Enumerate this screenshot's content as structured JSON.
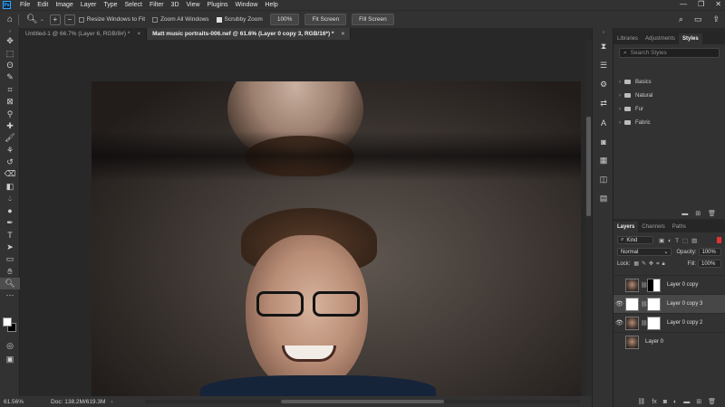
{
  "menubar": {
    "logo": "Ps",
    "items": [
      "File",
      "Edit",
      "Image",
      "Layer",
      "Type",
      "Select",
      "Filter",
      "3D",
      "View",
      "Plugins",
      "Window",
      "Help"
    ],
    "window_controls": [
      "—",
      "❐",
      "✕"
    ]
  },
  "options_bar": {
    "resize_windows": "Resize Windows to Fit",
    "zoom_all": "Zoom All Windows",
    "scrubby_zoom": "Scrubby Zoom",
    "zoom_value": "100%",
    "fit_screen": "Fit Screen",
    "fill_screen": "Fill Screen",
    "checks": {
      "resize_windows": false,
      "zoom_all": false,
      "scrubby_zoom": true
    }
  },
  "tabs": [
    {
      "label": "Untitled-1 @ 66.7% (Layer 6, RGB/8#) *",
      "active": false
    },
    {
      "label": "Matt music portraits-006.nef @ 61.6% (Layer 0 copy 3, RGB/16*) *",
      "active": true
    }
  ],
  "status": {
    "zoom": "61.56%",
    "doc": "Doc: 138.2M/619.3M"
  },
  "styles_panel": {
    "tabs": [
      "Libraries",
      "Adjustments",
      "Styles"
    ],
    "search_placeholder": "Search Styles",
    "folders": [
      "Basics",
      "Natural",
      "Fur",
      "Fabric"
    ]
  },
  "layers_panel": {
    "tabs": [
      "Layers",
      "Channels",
      "Paths"
    ],
    "kind": "Kind",
    "blend_mode": "Normal",
    "opacity_label": "Opacity:",
    "opacity_value": "100%",
    "lock_label": "Lock:",
    "fill_label": "Fill:",
    "fill_value": "100%",
    "layers": [
      {
        "name": "Layer 0 copy",
        "visible": false,
        "selected": false,
        "mask": "mask"
      },
      {
        "name": "Layer 0 copy 3",
        "visible": true,
        "selected": true,
        "mask": "white"
      },
      {
        "name": "Layer 0 copy 2",
        "visible": true,
        "selected": false,
        "mask": "white"
      },
      {
        "name": "Layer 0",
        "visible": false,
        "selected": false,
        "mask": null
      }
    ],
    "footer_icons": [
      "link-icon",
      "fx-icon",
      "mask-icon",
      "adjustment-icon",
      "folder-icon",
      "new-layer-icon",
      "trash-icon"
    ]
  }
}
